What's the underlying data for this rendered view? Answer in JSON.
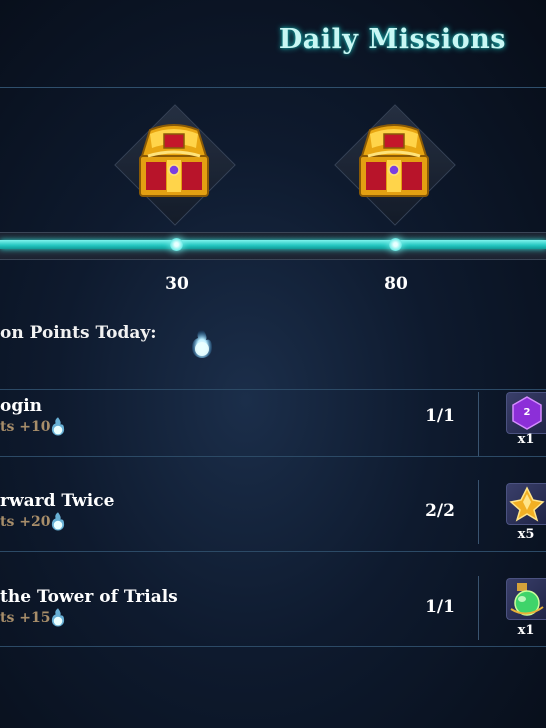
{
  "header": {
    "title": "Daily Missions"
  },
  "progress": {
    "milestones": [
      {
        "points": "30",
        "icon": "treasure-chest"
      },
      {
        "points": "80",
        "icon": "treasure-chest"
      }
    ],
    "fill_color": "#23c6c0"
  },
  "points_today": {
    "label": "on Points Today:",
    "icon": "blue-flame"
  },
  "missions": [
    {
      "name": "ogin",
      "reward": "ts +10",
      "progress": "1/1",
      "item_qty": "x1",
      "item_icon": "purple-ticket-icon"
    },
    {
      "name": "rward Twice",
      "reward": "ts +20",
      "progress": "2/2",
      "item_qty": "x5",
      "item_icon": "gold-crystal-icon"
    },
    {
      "name": " the Tower of Trials",
      "reward": "ts +15",
      "progress": "1/1",
      "item_qty": "x1",
      "item_icon": "green-potion-icon"
    }
  ],
  "colors": {
    "title_glow": "#1ec8c8",
    "reward_text": "#a88e6a",
    "flame": "#7fd6ff"
  }
}
